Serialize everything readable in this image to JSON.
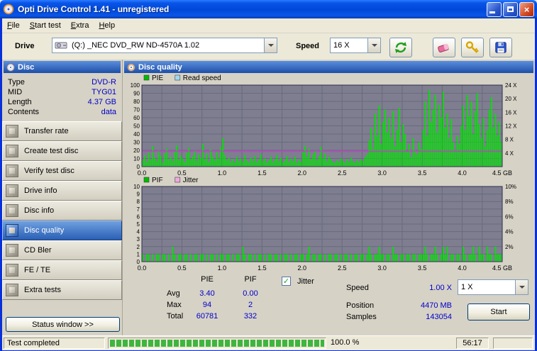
{
  "window": {
    "title": "Opti Drive Control 1.41 - unregistered"
  },
  "menu": {
    "items": [
      "File",
      "Start test",
      "Extra",
      "Help"
    ]
  },
  "toolbar": {
    "drive_label": "Drive",
    "drive_value": "(Q:) _NEC DVD_RW ND-4570A 1.02",
    "speed_label": "Speed",
    "speed_value": "16 X"
  },
  "sidebar": {
    "header": "Disc",
    "info": [
      {
        "label": "Type",
        "value": "DVD-R"
      },
      {
        "label": "MID",
        "value": "TYG01"
      },
      {
        "label": "Length",
        "value": "4.37 GB"
      },
      {
        "label": "Contents",
        "value": "data"
      }
    ],
    "buttons": [
      {
        "label": "Transfer rate"
      },
      {
        "label": "Create test disc"
      },
      {
        "label": "Verify test disc"
      },
      {
        "label": "Drive info"
      },
      {
        "label": "Disc info"
      },
      {
        "label": "Disc quality",
        "selected": true
      },
      {
        "label": "CD Bler"
      },
      {
        "label": "FE / TE"
      },
      {
        "label": "Extra tests"
      }
    ],
    "status_window": "Status window >>"
  },
  "main": {
    "header": "Disc quality",
    "stats": {
      "col_pie": "PIE",
      "col_pif": "PIF",
      "rows": [
        {
          "label": "Avg",
          "pie": "3.40",
          "pif": "0.00"
        },
        {
          "label": "Max",
          "pie": "94",
          "pif": "2"
        },
        {
          "label": "Total",
          "pie": "60781",
          "pif": "332"
        }
      ],
      "jitter_label": "Jitter",
      "jitter_checked": true,
      "jitter_check_glyph": "✓",
      "fields": [
        {
          "label": "Speed",
          "value": "1.00 X"
        },
        {
          "label": "Position",
          "value": "4470 MB"
        },
        {
          "label": "Samples",
          "value": "143054"
        }
      ],
      "speed_select": "1 X",
      "start_button": "Start"
    }
  },
  "statusbar": {
    "status": "Test completed",
    "progress": "100.0 %",
    "progress_pct": 100,
    "time": "56:17"
  },
  "colors": {
    "accent_blue": "#0831D9",
    "value_blue": "#0000C8",
    "pie_green": "#00E400",
    "read_speed_magenta": "#C044C4",
    "progress_green": "#3FB53F"
  },
  "chart_data": [
    {
      "type": "bar",
      "title": "PIE / Read speed vs position",
      "legend": [
        {
          "label": "PIE",
          "color": "#00BB00"
        },
        {
          "label": "Read speed",
          "color": "#9FD9EF"
        }
      ],
      "y_ticks": [
        0,
        10,
        20,
        30,
        40,
        50,
        60,
        70,
        80,
        90,
        100
      ],
      "right_axis_max": 24,
      "right_ticks": [
        {
          "label": "24 X",
          "value": 24
        },
        {
          "label": "20 X",
          "value": 20
        },
        {
          "label": "16 X",
          "value": 16
        },
        {
          "label": "12 X",
          "value": 12
        },
        {
          "label": "8 X",
          "value": 8
        },
        {
          "label": "4 X",
          "value": 4
        }
      ],
      "x_ticks": [
        "0.0",
        "0.5",
        "1.0",
        "1.5",
        "2.0",
        "2.5",
        "3.0",
        "3.5",
        "4.0",
        "4.5 GB"
      ],
      "x_max_gb": 4.5,
      "x_divisions": 18,
      "read_speed_line_x": 4.5,
      "series_color": "#00E400",
      "read_speed_color": "#C044C4",
      "bg_color": "#7E7E90",
      "grid_color": "#6A6A7E",
      "border_color": "#2E2E4E",
      "values": [
        8,
        14,
        6,
        18,
        9,
        25,
        11,
        7,
        20,
        13,
        5,
        16,
        22,
        9,
        12,
        7,
        19,
        26,
        8,
        14,
        10,
        6,
        17,
        23,
        9,
        13,
        20,
        7,
        15,
        11,
        28,
        9,
        16,
        6,
        21,
        12,
        8,
        18,
        10,
        24,
        35,
        14,
        8,
        11,
        6,
        9,
        5,
        12,
        7,
        10,
        6,
        14,
        8,
        5,
        11,
        7,
        13,
        6,
        9,
        15,
        7,
        10,
        5,
        8,
        12,
        6,
        9,
        14,
        7,
        11,
        5,
        8,
        13,
        6,
        10,
        7,
        12,
        5,
        9,
        6,
        18,
        25,
        12,
        22,
        9,
        15,
        20,
        8,
        13,
        24,
        10,
        16,
        7,
        12,
        9,
        6,
        5,
        8,
        6,
        10,
        7,
        5,
        9,
        6,
        11,
        7,
        5,
        8,
        6,
        9,
        7,
        12,
        15,
        32,
        48,
        22,
        65,
        38,
        75,
        28,
        55,
        70,
        42,
        60,
        35,
        68,
        25,
        45,
        72,
        30,
        52,
        40,
        18,
        28,
        12,
        35,
        20,
        15,
        30,
        22,
        45,
        80,
        38,
        94,
        55,
        70,
        88,
        42,
        76,
        60,
        92,
        48,
        65,
        35,
        58,
        30,
        20,
        38,
        28,
        50,
        75,
        45,
        88,
        62,
        80,
        40,
        68,
        90,
        52,
        35,
        60,
        25,
        45,
        70,
        85,
        48,
        65,
        38,
        55,
        30
      ]
    },
    {
      "type": "bar",
      "title": "PIF / Jitter vs position",
      "legend": [
        {
          "label": "PIF",
          "color": "#00BB00"
        },
        {
          "label": "Jitter",
          "color": "#EFA9DF"
        }
      ],
      "y_ticks": [
        0,
        1,
        2,
        3,
        4,
        5,
        6,
        7,
        8,
        9,
        10
      ],
      "right_axis_max": 10,
      "right_ticks": [
        {
          "label": "10%",
          "value": 10
        },
        {
          "label": "8%",
          "value": 8
        },
        {
          "label": "6%",
          "value": 6
        },
        {
          "label": "4%",
          "value": 4
        },
        {
          "label": "2%",
          "value": 2
        }
      ],
      "x_ticks": [
        "0.0",
        "0.5",
        "1.0",
        "1.5",
        "2.0",
        "2.5",
        "3.0",
        "3.5",
        "4.0",
        "4.5 GB"
      ],
      "x_max_gb": 4.5,
      "x_divisions": 18,
      "series_color": "#00E400",
      "bg_color": "#7E7E90",
      "grid_color": "#6A6A7E",
      "border_color": "#2E2E4E",
      "values": [
        1,
        0,
        1,
        1,
        0,
        1,
        0,
        1,
        1,
        0,
        1,
        1,
        0,
        1,
        0,
        2,
        1,
        0,
        1,
        1,
        0,
        1,
        1,
        0,
        1,
        0,
        1,
        1,
        0,
        1,
        1,
        0,
        1,
        0,
        1,
        1,
        0,
        1,
        0,
        1,
        1,
        0,
        1,
        1,
        0,
        1,
        0,
        1,
        1,
        0,
        2,
        1,
        0,
        1,
        1,
        0,
        1,
        0,
        1,
        1,
        0,
        1,
        0,
        1,
        1,
        0,
        1,
        1,
        0,
        1,
        0,
        1,
        1,
        0,
        1,
        0,
        1,
        1,
        0,
        1,
        1,
        0,
        1,
        2,
        0,
        1,
        1,
        0,
        1,
        1,
        0,
        1,
        0,
        1,
        1,
        0,
        1,
        1,
        0,
        1,
        0,
        1,
        1,
        0,
        1,
        0,
        1,
        1,
        0,
        1,
        1,
        0,
        1,
        2,
        1,
        0,
        1,
        1,
        2,
        1,
        1,
        0,
        1,
        1,
        0,
        2,
        1,
        1,
        0,
        1,
        1,
        0,
        1,
        1,
        0,
        1,
        1,
        0,
        1,
        1,
        1,
        2,
        1,
        0,
        1,
        1,
        2,
        1,
        0,
        1,
        2,
        1,
        2,
        0,
        1,
        1,
        0,
        1,
        1,
        0,
        2,
        1,
        0,
        1,
        1,
        2,
        1,
        0,
        2,
        1,
        1,
        0,
        2,
        1,
        1,
        0,
        2,
        1,
        1,
        1
      ]
    }
  ]
}
